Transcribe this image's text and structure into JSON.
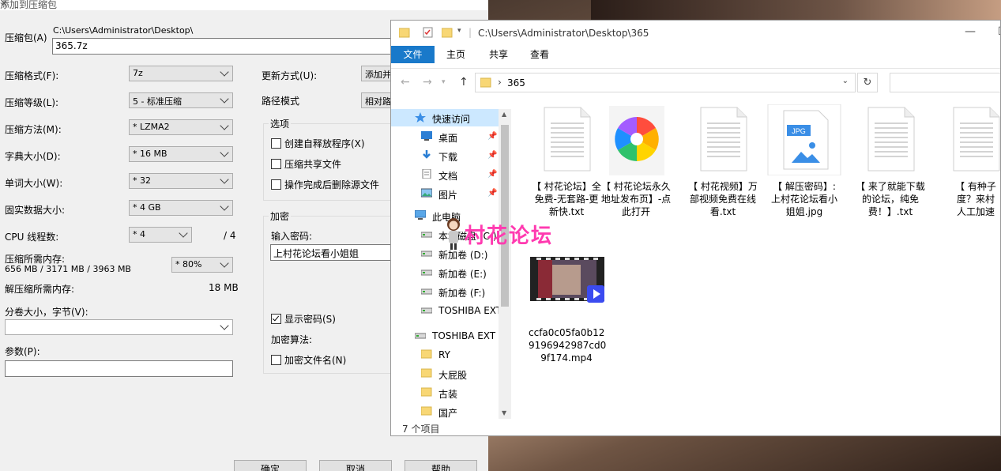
{
  "dialog": {
    "title": "添加到压缩包",
    "archive_label": "压缩包(A)",
    "archive_dir": "C:\\Users\\Administrator\\Desktop\\",
    "archive_name": "365.7z",
    "format_label": "压缩格式(F):",
    "format_value": "7z",
    "level_label": "压缩等级(L):",
    "level_value": "5 - 标准压缩",
    "method_label": "压缩方法(M):",
    "method_value": "*  LZMA2",
    "dict_label": "字典大小(D):",
    "dict_value": "*  16 MB",
    "word_label": "单词大小(W):",
    "word_value": "*  32",
    "solid_label": "固实数据大小:",
    "solid_value": "*  4 GB",
    "cpu_label": "CPU 线程数:",
    "cpu_value": "*  4",
    "cpu_total": "/ 4",
    "mem_label": "压缩所需内存:",
    "mem_value": "656 MB / 3171 MB / 3963 MB",
    "mem_percent": "* 80%",
    "decomp_label": "解压缩所需内存:",
    "decomp_value": "18 MB",
    "split_label": "分卷大小，字节(V):",
    "params_label": "参数(P):",
    "update_label": "更新方式(U):",
    "update_value": "添加并",
    "pathmode_label": "路径模式",
    "pathmode_value": "相对路",
    "options_title": "选项",
    "opt_sfx": "创建自释放程序(X)",
    "opt_shared": "压缩共享文件",
    "opt_delete": "操作完成后删除源文件",
    "enc_title": "加密",
    "enc_pwd_label": "输入密码:",
    "enc_pwd_value": "上村花论坛看小姐姐",
    "enc_show": "显示密码(S)",
    "enc_method_label": "加密算法:",
    "enc_names": "加密文件名(N)",
    "btn_ok": "确定",
    "btn_cancel": "取消",
    "btn_help": "帮助"
  },
  "explorer": {
    "title_path": "C:\\Users\\Administrator\\Desktop\\365",
    "tabs": [
      "文件",
      "主页",
      "共享",
      "查看"
    ],
    "address_segment": "365",
    "nav": [
      {
        "label": "快速访问",
        "icon": "star-icon",
        "pinned": false
      },
      {
        "label": "桌面",
        "icon": "desktop-icon",
        "pinned": true
      },
      {
        "label": "下载",
        "icon": "download-icon",
        "pinned": true
      },
      {
        "label": "文档",
        "icon": "document-icon",
        "pinned": true
      },
      {
        "label": "图片",
        "icon": "picture-icon",
        "pinned": true
      },
      {
        "label": "此电脑",
        "icon": "computer-icon",
        "pinned": false
      },
      {
        "label": "本地磁盘 (C:)",
        "icon": "drive-icon",
        "pinned": false
      },
      {
        "label": "新加卷 (D:)",
        "icon": "drive-icon",
        "pinned": false
      },
      {
        "label": "新加卷 (E:)",
        "icon": "drive-icon",
        "pinned": false
      },
      {
        "label": "新加卷 (F:)",
        "icon": "drive-icon",
        "pinned": false
      },
      {
        "label": "TOSHIBA EXT",
        "icon": "drive-icon",
        "pinned": false
      },
      {
        "label": "TOSHIBA EXT (",
        "icon": "drive-icon",
        "pinned": false
      },
      {
        "label": "RY",
        "icon": "folder-icon",
        "pinned": false
      },
      {
        "label": "大屁股",
        "icon": "folder-icon",
        "pinned": false
      },
      {
        "label": "古装",
        "icon": "folder-icon",
        "pinned": false
      },
      {
        "label": "国产",
        "icon": "folder-icon",
        "pinned": false
      }
    ],
    "files": [
      {
        "name": "【 村花论坛】全免费-无套路-更新快.txt",
        "lines": [
          "【 村花论坛】全",
          "免费-无套路-更",
          "新快.txt"
        ],
        "kind": "txt"
      },
      {
        "name": "【 村花论坛永久地址发布页】-点此打开",
        "lines": [
          "【 村花论坛永久",
          "地址发布页】-点",
          "此打开"
        ],
        "kind": "pinwheel"
      },
      {
        "name": "【 村花视频】万部视频免费在线看.txt",
        "lines": [
          "【 村花视频】万",
          "部视频免费在线",
          "看.txt"
        ],
        "kind": "txt"
      },
      {
        "name": "【 解压密码】:上村花论坛看小姐姐.jpg",
        "lines": [
          "【 解压密码】:",
          "上村花论坛看小",
          "姐姐.jpg"
        ],
        "kind": "jpg"
      },
      {
        "name": "【 来了就能下载的论坛，纯免费！】.txt",
        "lines": [
          "【 来了就能下载",
          "的论坛，纯免",
          "费！】.txt"
        ],
        "kind": "txt"
      },
      {
        "name": "【 有种子度？来村人工加速",
        "lines": [
          "【 有种子",
          "度？来村",
          "人工加速"
        ],
        "kind": "txt"
      },
      {
        "name": "ccfa0c05fa0b129196942987cd09f174.mp4",
        "lines": [
          "ccfa0c05fa0b12",
          "9196942987cd0",
          "9f174.mp4"
        ],
        "kind": "mp4"
      }
    ],
    "status": "7 个项目",
    "jpg_badge": "JPG"
  },
  "watermark": {
    "text": "村花论坛",
    "color": "#ff3ab0"
  }
}
